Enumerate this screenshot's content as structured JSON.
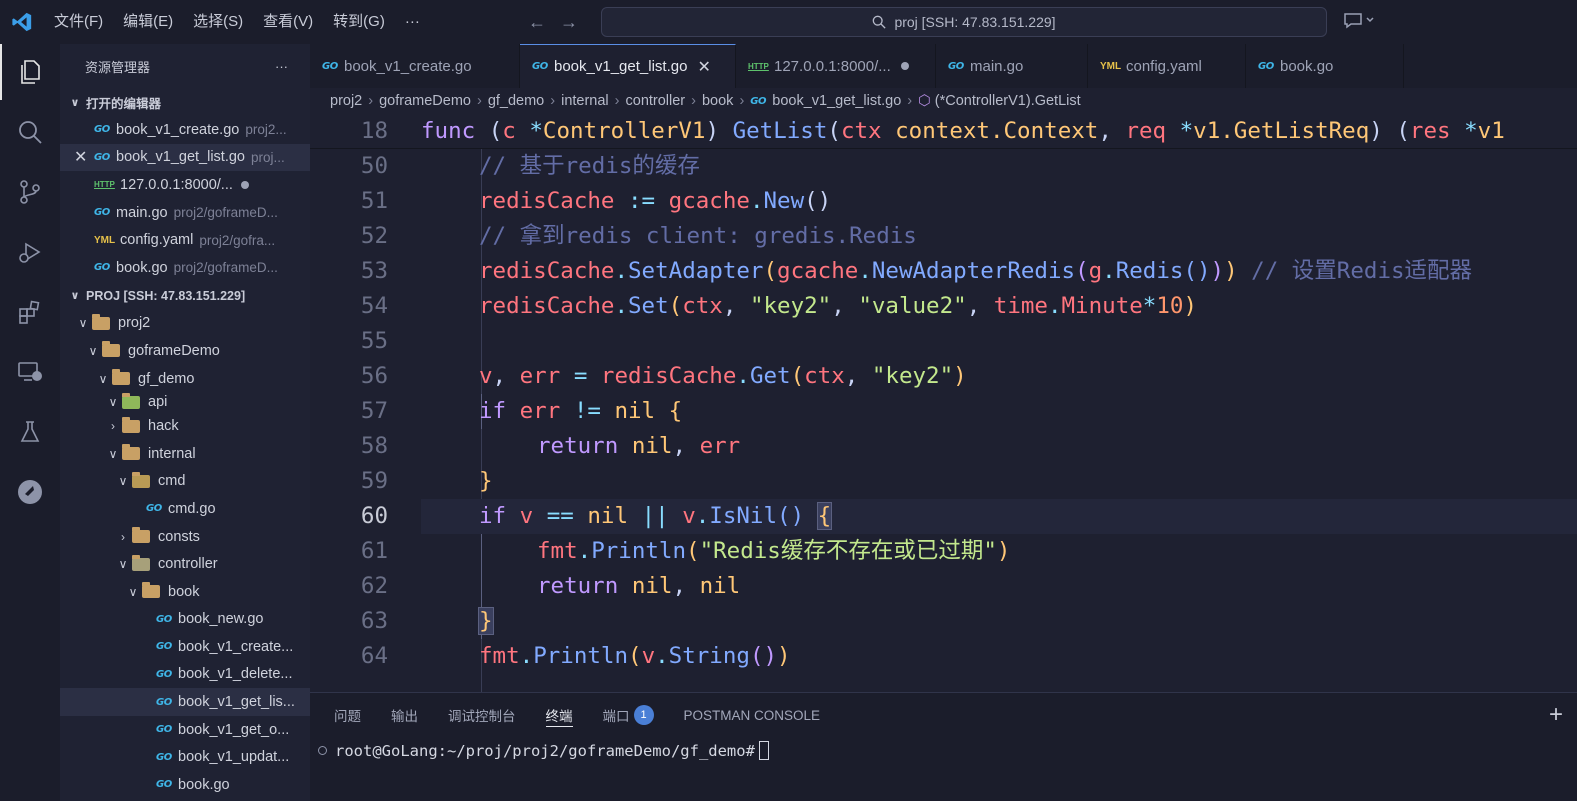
{
  "titlebar": {
    "menu": [
      "文件(F)",
      "编辑(E)",
      "选择(S)",
      "查看(V)",
      "转到(G)",
      "···"
    ],
    "search": "proj [SSH: 47.83.151.229]"
  },
  "sidebar": {
    "title": "资源管理器",
    "more": "···",
    "open_editors_label": "打开的编辑器",
    "open_editors": [
      {
        "name": "book_v1_create.go",
        "path": "proj2..."
      },
      {
        "name": "book_v1_get_list.go",
        "path": "proj..."
      },
      {
        "name": "127.0.0.1:8000/...",
        "path": ""
      },
      {
        "name": "main.go",
        "path": "proj2/goframeD..."
      },
      {
        "name": "config.yaml",
        "path": "proj2/gofra..."
      },
      {
        "name": "book.go",
        "path": "proj2/goframeD..."
      }
    ],
    "project_label": "PROJ [SSH: 47.83.151.229]",
    "tree": [
      "proj2",
      "goframeDemo",
      "gf_demo",
      "api",
      "hack",
      "internal",
      "cmd",
      "cmd.go",
      "consts",
      "controller",
      "book",
      "book_new.go",
      "book_v1_create...",
      "book_v1_delete...",
      "book_v1_get_lis...",
      "book_v1_get_o...",
      "book_v1_updat...",
      "book.go"
    ]
  },
  "tabs": [
    "book_v1_create.go",
    "book_v1_get_list.go",
    "127.0.0.1:8000/...",
    "main.go",
    "config.yaml",
    "book.go"
  ],
  "breadcrumb": [
    "proj2",
    "goframeDemo",
    "gf_demo",
    "internal",
    "controller",
    "book",
    "book_v1_get_list.go",
    "(*ControllerV1).GetList"
  ],
  "editor": {
    "line_numbers": [
      "18",
      "50",
      "51",
      "52",
      "53",
      "54",
      "55",
      "56",
      "57",
      "58",
      "59",
      "60",
      "61",
      "62",
      "63",
      "64"
    ],
    "comment_1": "// 基于redis的缓存",
    "comment_2": "// 拿到redis client: gredis.Redis",
    "comment_3": "// 设置Redis适配器",
    "string_key": "\"key2\"",
    "string_value": "\"value2\"",
    "string_msg": "\"Redis缓存不存在或已过期\"",
    "number_10": "10"
  },
  "panel": {
    "tabs": [
      "问题",
      "输出",
      "调试控制台",
      "终端",
      "端口"
    ],
    "ports_badge": "1",
    "postman": "POSTMAN CONSOLE",
    "add": "+",
    "terminal_prompt": "root@GoLang:~/proj/proj2/goframeDemo/gf_demo#"
  }
}
